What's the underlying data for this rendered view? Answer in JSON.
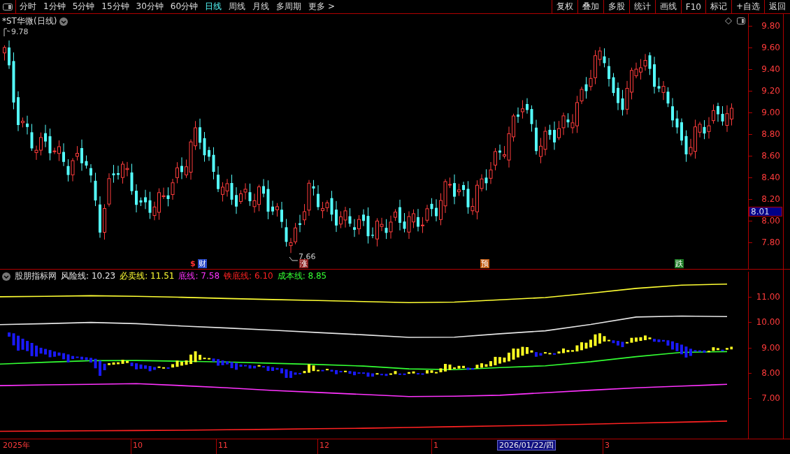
{
  "toolbar": {
    "periods": [
      {
        "label": "分时",
        "selected": false
      },
      {
        "label": "1分钟",
        "selected": false
      },
      {
        "label": "5分钟",
        "selected": false
      },
      {
        "label": "15分钟",
        "selected": false
      },
      {
        "label": "30分钟",
        "selected": false
      },
      {
        "label": "60分钟",
        "selected": false
      },
      {
        "label": "日线",
        "selected": true
      },
      {
        "label": "周线",
        "selected": false
      },
      {
        "label": "月线",
        "selected": false
      },
      {
        "label": "多周期",
        "selected": false
      },
      {
        "label": "更多 >",
        "selected": false
      }
    ],
    "actions": [
      "复权",
      "叠加",
      "多股",
      "统计",
      "画线",
      "F10",
      "标记",
      "+自选",
      "返回"
    ]
  },
  "chart": {
    "title": "*ST华微(日线)",
    "high_label": "9.78",
    "low_label": "7.66",
    "events": [
      {
        "prefix": "$",
        "text": "财",
        "color": "#2848c8"
      },
      {
        "text": "涨",
        "color": "#8c1c1c"
      },
      {
        "text": "预",
        "color": "#c05a10"
      },
      {
        "text": "跌",
        "color": "#1c7a24"
      }
    ],
    "price_ticks": [
      "9.80",
      "9.60",
      "9.40",
      "9.20",
      "9.00",
      "8.80",
      "8.60",
      "8.40",
      "8.20",
      "8.00",
      "7.80"
    ],
    "last_price": "8.01"
  },
  "indicator": {
    "name": "股朋指标网",
    "legend_values": [
      "10.23",
      "11.51",
      "7.58",
      "6.10",
      "8.85"
    ],
    "chart_data": {
      "type": "line",
      "ylim": [
        5.41,
        12.07
      ],
      "yticks": [
        {
          "value": 11,
          "label": "11.00"
        },
        {
          "value": 10,
          "label": "10.00"
        },
        {
          "value": 9,
          "label": "9.00"
        },
        {
          "value": 8,
          "label": "8.00"
        },
        {
          "value": 7,
          "label": "7.00"
        }
      ],
      "series": [
        {
          "name": "风险线:",
          "color": "#e6e6e6",
          "values": [
            9.9,
            9.94,
            9.99,
            9.94,
            9.85,
            9.77,
            9.68,
            9.59,
            9.5,
            9.4,
            9.41,
            9.54,
            9.66,
            9.91,
            10.2,
            10.24,
            10.22
          ]
        },
        {
          "name": "必卖线:",
          "color": "#ffff33",
          "values": [
            11.0,
            11.02,
            11.04,
            11.02,
            10.98,
            10.93,
            10.89,
            10.85,
            10.81,
            10.77,
            10.79,
            10.88,
            10.97,
            11.14,
            11.33,
            11.46,
            11.5
          ]
        },
        {
          "name": "底线:",
          "color": "#ff33ff",
          "values": [
            7.5,
            7.53,
            7.55,
            7.58,
            7.5,
            7.41,
            7.31,
            7.23,
            7.15,
            7.07,
            7.08,
            7.12,
            7.22,
            7.32,
            7.41,
            7.48,
            7.55
          ]
        },
        {
          "name": "铁底线:",
          "color": "#ff2222",
          "values": [
            5.7,
            5.71,
            5.72,
            5.73,
            5.74,
            5.76,
            5.78,
            5.8,
            5.82,
            5.85,
            5.88,
            5.91,
            5.94,
            5.98,
            6.02,
            6.06,
            6.1
          ]
        },
        {
          "name": "成本线:",
          "color": "#33ff33",
          "values": [
            8.35,
            8.42,
            8.48,
            8.49,
            8.46,
            8.43,
            8.38,
            8.33,
            8.27,
            8.16,
            8.13,
            8.21,
            8.28,
            8.44,
            8.64,
            8.81,
            8.84
          ]
        }
      ]
    }
  },
  "time_axis": {
    "labels": [
      "2025年",
      "10",
      "11",
      "12",
      "1",
      "3"
    ],
    "cursor_date": "2026/01/22/四"
  }
}
